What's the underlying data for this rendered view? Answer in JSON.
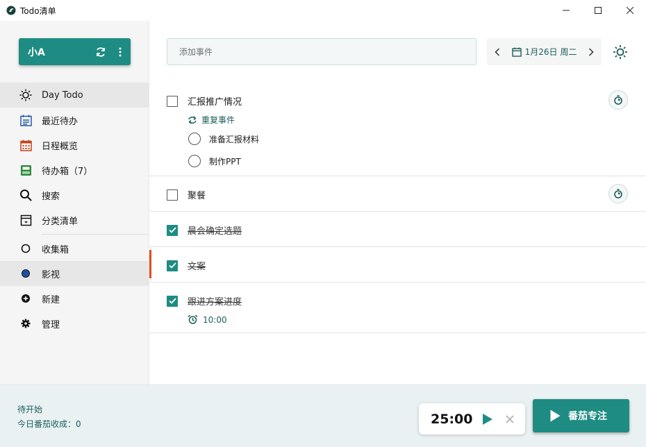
{
  "window": {
    "title": "Todo清单"
  },
  "user": {
    "name": "小A"
  },
  "nav": {
    "items": [
      {
        "label": "Day Todo",
        "icon": "sun-icon"
      },
      {
        "label": "最近待办",
        "icon": "calendar-list-icon"
      },
      {
        "label": "日程概览",
        "icon": "calendar-grid-icon"
      },
      {
        "label": "待办箱（7）",
        "icon": "inbox-icon"
      },
      {
        "label": "搜索",
        "icon": "search-icon"
      },
      {
        "label": "分类清单",
        "icon": "archive-icon"
      },
      {
        "label": "收集箱",
        "icon": "circle-outline-icon"
      },
      {
        "label": "影视",
        "icon": "circle-filled-icon"
      },
      {
        "label": "新建",
        "icon": "plus-circle-icon"
      },
      {
        "label": "管理",
        "icon": "gear-icon"
      }
    ]
  },
  "add": {
    "placeholder": "添加事件"
  },
  "date": {
    "label": "1月26日 周二"
  },
  "tasks": [
    {
      "title": "汇报推广情况",
      "done": false,
      "repeat_label": "重复事件",
      "subtasks": [
        "准备汇报材料",
        "制作PPT"
      ]
    },
    {
      "title": "聚餐",
      "done": false
    },
    {
      "title": "晨会确定选题",
      "done": true
    },
    {
      "title": "文案",
      "done": true
    },
    {
      "title": "跟进方案进度",
      "done": true,
      "alarm": "10:00"
    }
  ],
  "footer": {
    "status": "待开始",
    "harvest": "今日番茄收成：0",
    "timer": "25:00",
    "focus_label": "番茄专注"
  },
  "colors": {
    "accent": "#1e8c82",
    "focus_marker": "#e04e1b"
  }
}
